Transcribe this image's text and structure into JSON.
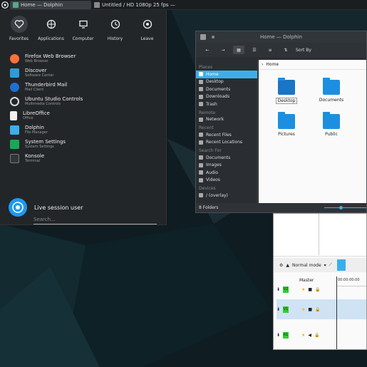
{
  "taskbar": {
    "tasks": [
      {
        "label": "Home — Dolphin",
        "icon": "folder-icon",
        "active": true
      },
      {
        "label": "Untitled / HD 1080p 25 fps —",
        "icon": "kdenlive-icon",
        "active": false
      }
    ]
  },
  "launcher": {
    "favorites": [
      {
        "label": "Favorites",
        "icon": "heart-icon"
      },
      {
        "label": "Applications",
        "icon": "grid-icon"
      },
      {
        "label": "Computer",
        "icon": "monitor-icon"
      },
      {
        "label": "History",
        "icon": "clock-icon"
      },
      {
        "label": "Leave",
        "icon": "power-icon"
      }
    ],
    "apps": [
      {
        "name": "Firefox Web Browser",
        "desc": "Web Browser",
        "icon": "firefox-icon",
        "color": "#ff7139"
      },
      {
        "name": "Discover",
        "desc": "Software Center",
        "icon": "discover-icon",
        "color": "#2b9cd9"
      },
      {
        "name": "Thunderbird Mail",
        "desc": "Mail Client",
        "icon": "thunderbird-icon",
        "color": "#1f6fd0"
      },
      {
        "name": "Ubuntu Studio Controls",
        "desc": "Multimedia Controls",
        "icon": "ubuntu-studio-icon",
        "color": "#dddddd"
      },
      {
        "name": "LibreOffice",
        "desc": "Office",
        "icon": "libreoffice-icon",
        "color": "#f0f0f0"
      },
      {
        "name": "Dolphin",
        "desc": "File Manager",
        "icon": "dolphin-icon",
        "color": "#3daee9"
      },
      {
        "name": "System Settings",
        "desc": "System Settings",
        "icon": "settings-icon",
        "color": "#19a657"
      },
      {
        "name": "Konsole",
        "desc": "Terminal",
        "icon": "konsole-icon",
        "color": "#31363b"
      }
    ],
    "user": "Live session user",
    "search_placeholder": "Search..."
  },
  "dolphin": {
    "title": "Home — Dolphin",
    "sort_label": "Sort By",
    "breadcrumb": "Home",
    "places": [
      {
        "type": "header",
        "label": "Places"
      },
      {
        "type": "item",
        "label": "Home",
        "selected": true
      },
      {
        "type": "item",
        "label": "Desktop"
      },
      {
        "type": "item",
        "label": "Documents"
      },
      {
        "type": "item",
        "label": "Downloads"
      },
      {
        "type": "item",
        "label": "Trash"
      },
      {
        "type": "header",
        "label": "Remote"
      },
      {
        "type": "item",
        "label": "Network"
      },
      {
        "type": "header",
        "label": "Recent"
      },
      {
        "type": "item",
        "label": "Recent Files"
      },
      {
        "type": "item",
        "label": "Recent Locations"
      },
      {
        "type": "header",
        "label": "Search For"
      },
      {
        "type": "item",
        "label": "Documents"
      },
      {
        "type": "item",
        "label": "Images"
      },
      {
        "type": "item",
        "label": "Audio"
      },
      {
        "type": "item",
        "label": "Videos"
      },
      {
        "type": "header",
        "label": "Devices"
      },
      {
        "type": "item",
        "label": "/ (overlay)"
      }
    ],
    "folders": [
      {
        "label": "Desktop",
        "selected": true
      },
      {
        "label": "Documents"
      },
      {
        "label": "Pictures"
      },
      {
        "label": "Public"
      }
    ],
    "status": "8 Folders",
    "zoom_level": 0.37
  },
  "kdenlive": {
    "mode": "Normal mode",
    "master": "Master",
    "timecode": "00:00:00:00",
    "tracks": [
      {
        "tag": "V2"
      },
      {
        "tag": "V1"
      },
      {
        "tag": "A1"
      }
    ]
  },
  "colors": {
    "accent": "#3daee9",
    "panel": "#232629",
    "folder": "#1d8fe0"
  }
}
